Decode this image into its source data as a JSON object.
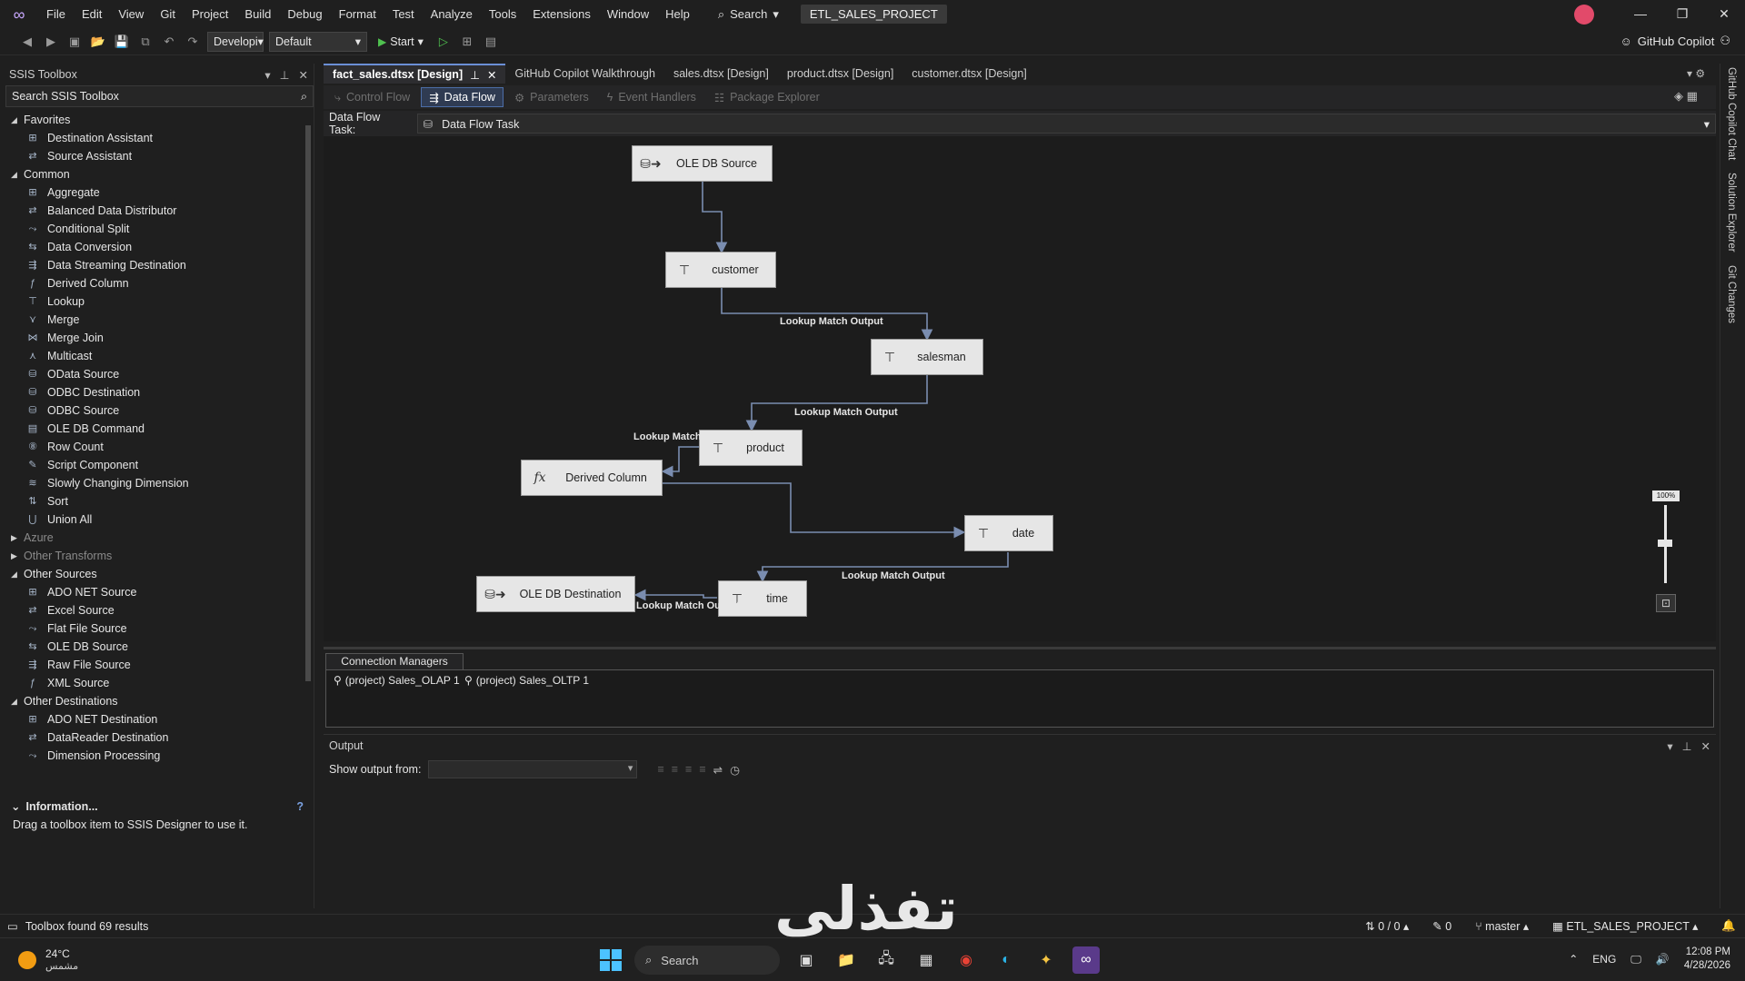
{
  "menu": [
    "File",
    "Edit",
    "View",
    "Git",
    "Project",
    "Build",
    "Debug",
    "Format",
    "Test",
    "Analyze",
    "Tools",
    "Extensions",
    "Window",
    "Help"
  ],
  "search_label": "Search",
  "project_name": "ETL_SALES_PROJECT",
  "toolbar": {
    "config": "Developi",
    "platform": "Default",
    "start_label": "Start",
    "copilot_label": "GitHub Copilot"
  },
  "toolbox": {
    "title": "SSIS Toolbox",
    "search_placeholder": "Search SSIS Toolbox",
    "groups": [
      {
        "name": "Favorites",
        "items": [
          "Destination Assistant",
          "Source Assistant"
        ]
      },
      {
        "name": "Common",
        "items": [
          "Aggregate",
          "Balanced Data Distributor",
          "Conditional Split",
          "Data Conversion",
          "Data Streaming Destination",
          "Derived Column",
          "Lookup",
          "Merge",
          "Merge Join",
          "Multicast",
          "OData Source",
          "ODBC Destination",
          "ODBC Source",
          "OLE DB Command",
          "Row Count",
          "Script Component",
          "Slowly Changing Dimension",
          "Sort",
          "Union All"
        ]
      },
      {
        "name": "Azure",
        "collapsed": true,
        "items": []
      },
      {
        "name": "Other Transforms",
        "collapsed": true,
        "items": []
      },
      {
        "name": "Other Sources",
        "items": [
          "ADO NET Source",
          "Excel Source",
          "Flat File Source",
          "OLE DB Source",
          "Raw File Source",
          "XML Source"
        ]
      },
      {
        "name": "Other Destinations",
        "items": [
          "ADO NET Destination",
          "DataReader Destination",
          "Dimension Processing"
        ]
      }
    ],
    "info_title": "Information...",
    "info_text": "Drag a toolbox item to SSIS Designer to use it."
  },
  "tabs": [
    "fact_sales.dtsx [Design]",
    "GitHub Copilot Walkthrough",
    "sales.dtsx [Design]",
    "product.dtsx [Design]",
    "customer.dtsx [Design]"
  ],
  "designer_tabs": [
    "Control Flow",
    "Data Flow",
    "Parameters",
    "Event Handlers",
    "Package Explorer"
  ],
  "dft_label": "Data Flow Task:",
  "dft_value": "Data Flow Task",
  "nodes": {
    "ole_src": "OLE DB Source",
    "customer": "customer",
    "salesman": "salesman",
    "product": "product",
    "derived": "Derived Column",
    "date": "date",
    "time": "time",
    "ole_dst": "OLE DB Destination"
  },
  "flow_labels": {
    "l1": "Lookup Match Output",
    "l2": "Lookup Match Output",
    "l3": "Lookup Match O",
    "l4": "Lookup Match Output",
    "l5": "Lookup Match Output"
  },
  "zoom_label": "100%",
  "conn_title": "Connection Managers",
  "connections": [
    "(project) Sales_OLAP 1",
    "(project) Sales_OLTP 1"
  ],
  "output": {
    "title": "Output",
    "show_label": "Show output from:"
  },
  "rail": [
    "GitHub Copilot Chat",
    "Solution Explorer",
    "Git Changes"
  ],
  "status": {
    "left": "Toolbox found 69 results",
    "counts": "0 / 0",
    "edits": "0",
    "branch": "master",
    "project": "ETL_SALES_PROJECT"
  },
  "watermark": "تفذلي",
  "taskbar": {
    "temp": "24°C",
    "weather": "مشمس",
    "search": "Search",
    "lang": "ENG",
    "time": "12:08 PM",
    "date": "4/28/2026"
  }
}
